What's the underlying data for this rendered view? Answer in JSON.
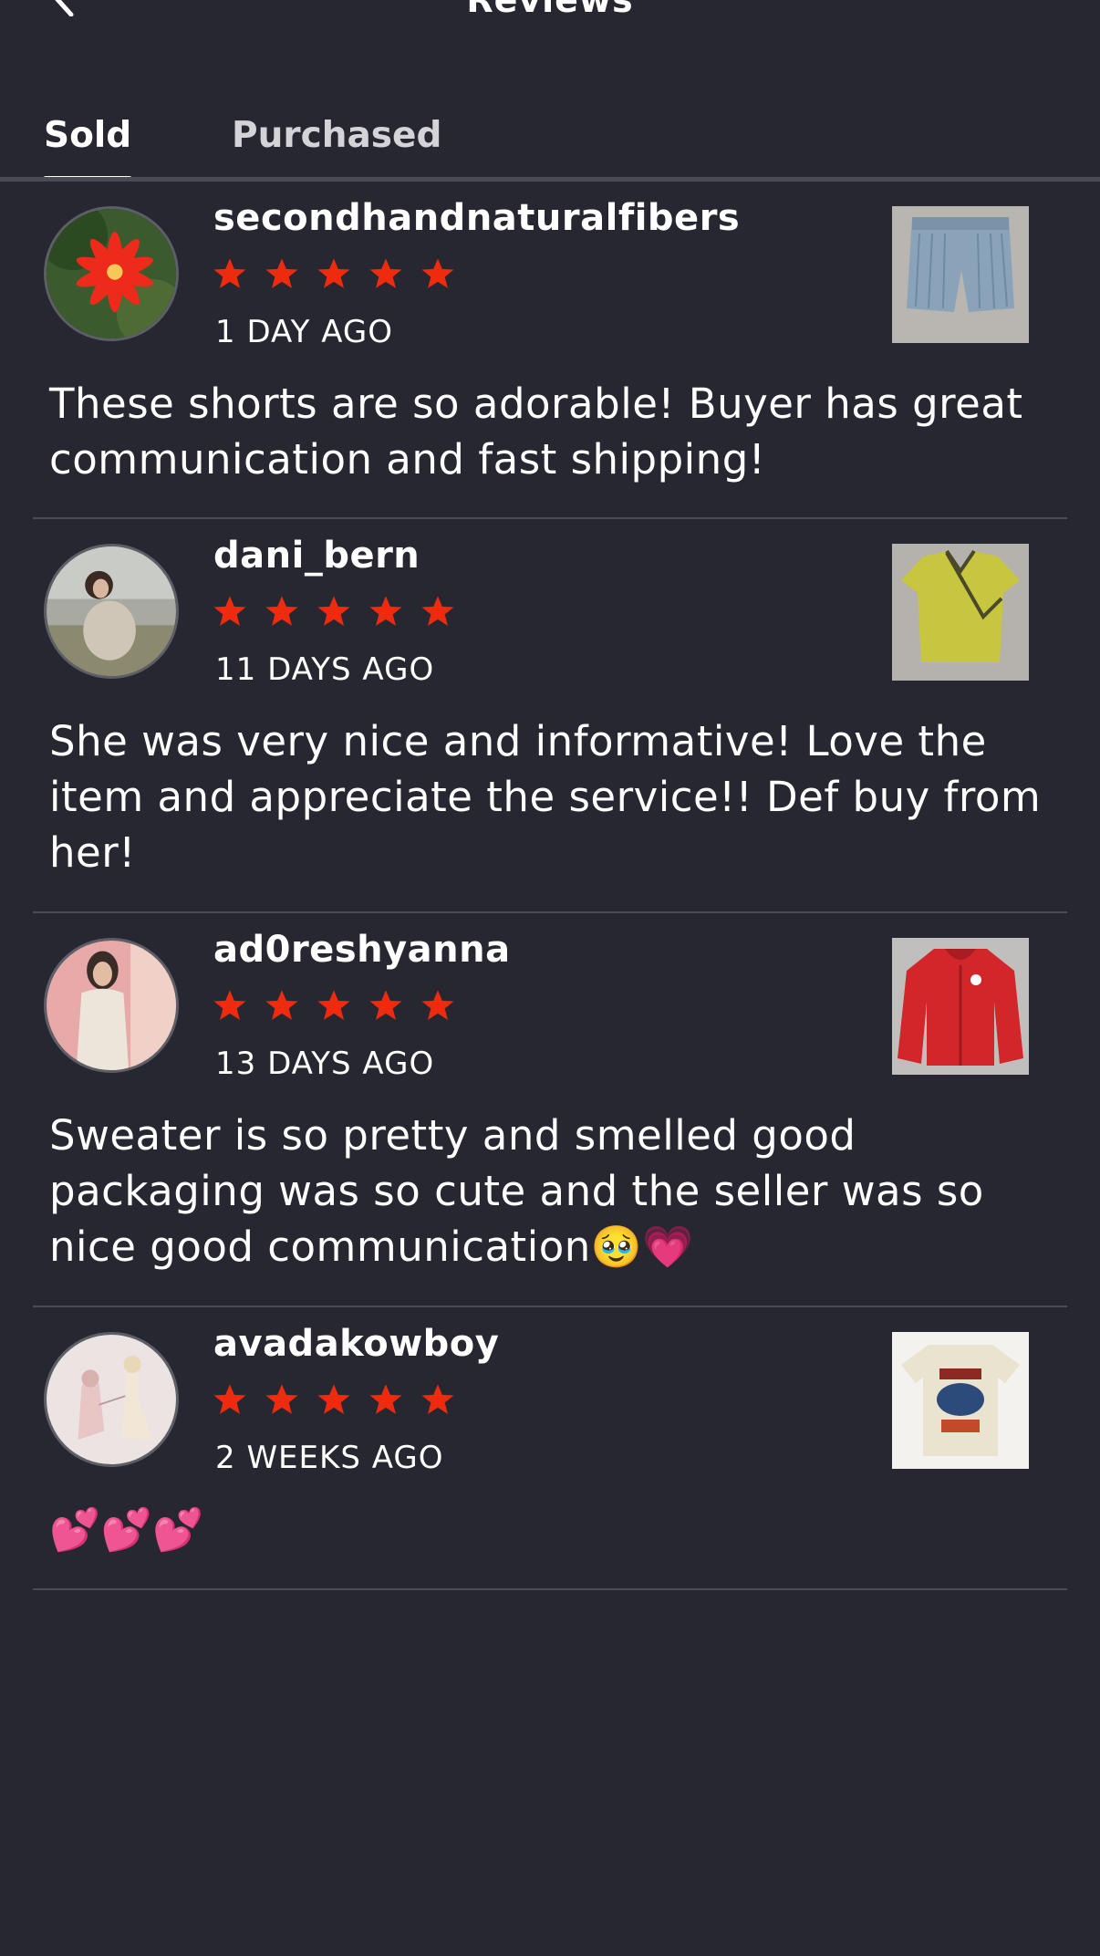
{
  "header": {
    "title": "Reviews"
  },
  "tabs": [
    {
      "label": "Sold",
      "active": true
    },
    {
      "label": "Purchased",
      "active": false
    }
  ],
  "colors": {
    "background": "#262730",
    "star": "#ee2b0f",
    "divider": "#4a4b55"
  },
  "reviews": [
    {
      "username": "secondhandnaturalfibers",
      "rating": 5,
      "time": "1 DAY AGO",
      "text": "These shorts are so adorable! Buyer has great communication and fast shipping!",
      "avatar": "red-flower-photo",
      "item": "denim-shorts-photo"
    },
    {
      "username": "dani_bern",
      "rating": 5,
      "time": "11 DAYS AGO",
      "text": "She was very nice and informative! Love the item and appreciate the service!! Def buy from her!",
      "avatar": "woman-in-field-photo",
      "item": "green-wrap-top-photo"
    },
    {
      "username": "ad0reshyanna",
      "rating": 5,
      "time": "13 DAYS AGO",
      "text": "Sweater is so pretty and smelled good packaging was so cute and the seller was so nice good communication🥹💗",
      "avatar": "mirror-selfie-photo",
      "item": "red-hoodie-photo"
    },
    {
      "username": "avadakowboy",
      "rating": 5,
      "time": "2 WEEKS AGO",
      "text": "💕💕💕",
      "avatar": "fairy-drawing",
      "item": "graphic-tee-photo"
    }
  ]
}
